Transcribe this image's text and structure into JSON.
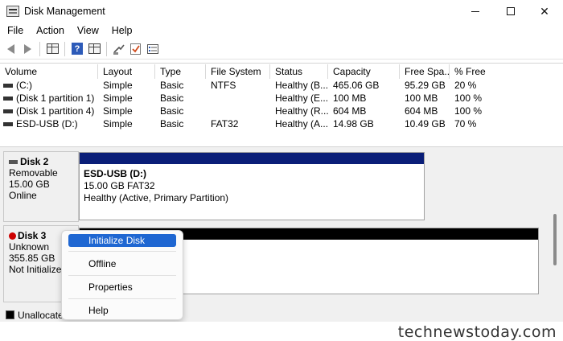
{
  "window": {
    "title": "Disk Management",
    "minimize_label": "",
    "maximize_label": "",
    "close_label": "✕"
  },
  "menu": [
    "File",
    "Action",
    "View",
    "Help"
  ],
  "toolbar": {
    "help_glyph": "?",
    "icons": [
      "back-arrow-icon",
      "forward-arrow-icon",
      "console-tree-icon",
      "help-icon",
      "properties-icon",
      "rescan-icon",
      "check-icon",
      "list-icon"
    ]
  },
  "volume_list": {
    "columns": [
      "Volume",
      "Layout",
      "Type",
      "File System",
      "Status",
      "Capacity",
      "Free Spa...",
      "% Free"
    ],
    "rows": [
      {
        "volume": " (C:)",
        "layout": "Simple",
        "type": "Basic",
        "fs": "NTFS",
        "status": "Healthy (B...",
        "capacity": "465.06 GB",
        "free": "95.29 GB",
        "pct": "20 %"
      },
      {
        "volume": "(Disk 1 partition 1)",
        "layout": "Simple",
        "type": "Basic",
        "fs": "",
        "status": "Healthy (E...",
        "capacity": "100 MB",
        "free": "100 MB",
        "pct": "100 %"
      },
      {
        "volume": "(Disk 1 partition 4)",
        "layout": "Simple",
        "type": "Basic",
        "fs": "",
        "status": "Healthy (R...",
        "capacity": "604 MB",
        "free": "604 MB",
        "pct": "100 %"
      },
      {
        "volume": "ESD-USB (D:)",
        "layout": "Simple",
        "type": "Basic",
        "fs": "FAT32",
        "status": "Healthy (A...",
        "capacity": "14.98 GB",
        "free": "10.49 GB",
        "pct": "70 %"
      }
    ]
  },
  "disks": [
    {
      "name": "Disk 2",
      "kind": "Removable",
      "size": "15.00 GB",
      "state": "Online",
      "partition": {
        "label": "ESD-USB  (D:)",
        "detail": "15.00 GB FAT32",
        "status": "Healthy (Active, Primary Partition)",
        "bar_color": "#0a1e78"
      }
    },
    {
      "name": "Disk 3",
      "kind": "Unknown",
      "size": "355.85 GB",
      "state": "Not Initialized",
      "partition": {
        "bar_color": "#000000"
      }
    }
  ],
  "legend": {
    "label": "Unallocated",
    "color": "#000000"
  },
  "context_menu": {
    "items": [
      "Initialize Disk",
      "Offline",
      "Properties",
      "Help"
    ],
    "selected": "Initialize Disk",
    "highlight_color": "#1f67d2"
  },
  "watermark": "technewstoday.com"
}
